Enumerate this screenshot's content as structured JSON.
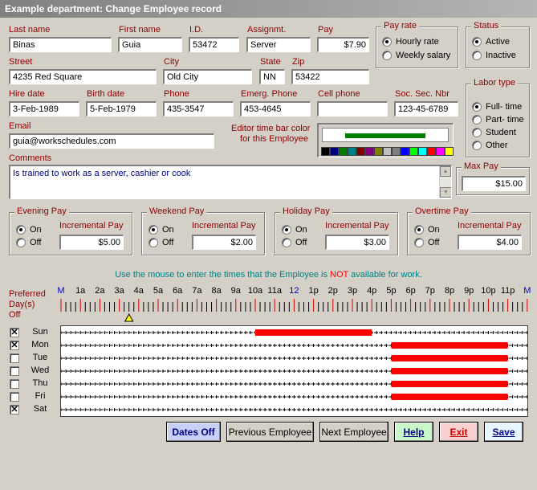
{
  "window": {
    "title": "Example department: Change Employee record"
  },
  "fields": {
    "last_name": {
      "label": "Last name",
      "value": "Binas"
    },
    "first_name": {
      "label": "First name",
      "value": "Guia"
    },
    "id": {
      "label": "I.D.",
      "value": "53472"
    },
    "assignment": {
      "label": "Assignmt.",
      "value": "Server"
    },
    "pay": {
      "label": "Pay",
      "value": "$7.90"
    },
    "street": {
      "label": "Street",
      "value": "4235 Red Square"
    },
    "city": {
      "label": "City",
      "value": "Old City"
    },
    "state": {
      "label": "State",
      "value": "NN"
    },
    "zip": {
      "label": "Zip",
      "value": "53422"
    },
    "hire_date": {
      "label": "Hire date",
      "value": "3-Feb-1989"
    },
    "birth_date": {
      "label": "Birth date",
      "value": "5-Feb-1979"
    },
    "phone": {
      "label": "Phone",
      "value": "435-3547"
    },
    "emerg_phone": {
      "label": "Emerg. Phone",
      "value": "453-4645"
    },
    "cell_phone": {
      "label": "Cell phone",
      "value": ""
    },
    "ssn": {
      "label": "Soc. Sec. Nbr",
      "value": "123-45-6789"
    },
    "email": {
      "label": "Email",
      "value": "guia@workschedules.com"
    },
    "comments": {
      "label": "Comments",
      "value": "Is trained to work as a server, cashier or cook"
    }
  },
  "editor_color": {
    "label_line1": "Editor time bar color",
    "label_line2": "for this Employee",
    "selected_color": "#008000"
  },
  "palette": [
    "#000000",
    "#000080",
    "#008000",
    "#008080",
    "#800000",
    "#800080",
    "#808000",
    "#c0c0c0",
    "#808080",
    "#0000ff",
    "#00ff00",
    "#00ffff",
    "#ff0000",
    "#ff00ff",
    "#ffff00"
  ],
  "pay_rate": {
    "title": "Pay rate",
    "options": [
      "Hourly rate",
      "Weekly salary"
    ],
    "selected": "Hourly rate"
  },
  "status": {
    "title": "Status",
    "options": [
      "Active",
      "Inactive"
    ],
    "selected": "Active"
  },
  "labor_type": {
    "title": "Labor type",
    "options": [
      "Full- time",
      "Part- time",
      "Student",
      "Other"
    ],
    "selected": "Full- time"
  },
  "max_pay": {
    "title": "Max Pay",
    "value": "$15.00"
  },
  "evening_pay": {
    "title": "Evening Pay",
    "on_label": "On",
    "off_label": "Off",
    "inc_label": "Incremental Pay",
    "value": "$5.00",
    "selected": "On"
  },
  "weekend_pay": {
    "title": "Weekend Pay",
    "on_label": "On",
    "off_label": "Off",
    "inc_label": "Incremental Pay",
    "value": "$2.00",
    "selected": "On"
  },
  "holiday_pay": {
    "title": "Holiday Pay",
    "on_label": "On",
    "off_label": "Off",
    "inc_label": "Incremental Pay",
    "value": "$3.00",
    "selected": "On"
  },
  "overtime_pay": {
    "title": "Overtime Pay",
    "on_label": "On",
    "off_label": "Off",
    "inc_label": "Incremental Pay",
    "value": "$4.00",
    "selected": "On"
  },
  "availability": {
    "instruction_pre": "Use the mouse to enter the times that the Employee is",
    "instruction_not": "NOT",
    "instruction_post": "available for work.",
    "preferred_label": [
      "Preferred",
      "Day(s)",
      "Off"
    ],
    "hours": [
      "M",
      "1a",
      "2a",
      "3a",
      "4a",
      "5a",
      "6a",
      "7a",
      "8a",
      "9a",
      "10a",
      "11a",
      "12",
      "1p",
      "2p",
      "3p",
      "4p",
      "5p",
      "6p",
      "7p",
      "8p",
      "9p",
      "10p",
      "11p",
      "M"
    ],
    "days": [
      {
        "name": "Sun",
        "off": true,
        "unavailable": [
          [
            10,
            16
          ]
        ]
      },
      {
        "name": "Mon",
        "off": true,
        "unavailable": [
          [
            17,
            23
          ]
        ]
      },
      {
        "name": "Tue",
        "off": false,
        "unavailable": [
          [
            17,
            23
          ]
        ]
      },
      {
        "name": "Wed",
        "off": false,
        "unavailable": [
          [
            17,
            23
          ]
        ]
      },
      {
        "name": "Thu",
        "off": false,
        "unavailable": [
          [
            17,
            23
          ]
        ]
      },
      {
        "name": "Fri",
        "off": false,
        "unavailable": [
          [
            17,
            23
          ]
        ]
      },
      {
        "name": "Sat",
        "off": true,
        "unavailable": []
      }
    ]
  },
  "buttons": {
    "dates_off": "Dates Off",
    "previous_employee": "Previous Employee",
    "next_employee": "Next Employee",
    "help": "Help",
    "exit": "Exit",
    "save": "Save"
  }
}
